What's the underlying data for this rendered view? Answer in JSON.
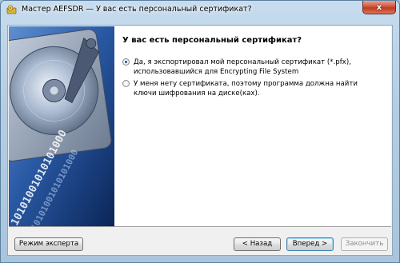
{
  "window": {
    "title": "Мастер AEFSDR — У вас есть персональный сертификат?",
    "close_glyph": "x"
  },
  "content": {
    "heading": "У вас есть персональный сертификат?",
    "options": [
      {
        "label": "Да, я экспортировал мой персональный сертификат (*.pfx), использовавшийся для Encrypting File System",
        "checked": true
      },
      {
        "label": "У меня нету сертификата, поэтому программа должна найти ключи шифрования на диске(ках).",
        "checked": false
      }
    ]
  },
  "buttons": {
    "expert": "Режим эксперта",
    "back": "< Назад",
    "next": "Вперед >",
    "finish": "Закончить"
  },
  "side_image": {
    "binary_text": "10101001010101000"
  },
  "colors": {
    "title_gradient_top": "#c7dcee",
    "close_button": "#c13a20",
    "pane_background": "#ffffff",
    "dialog_background": "#f0f0f0",
    "side_image_dark": "#0e2d63",
    "side_image_light": "#6fa0d8"
  }
}
